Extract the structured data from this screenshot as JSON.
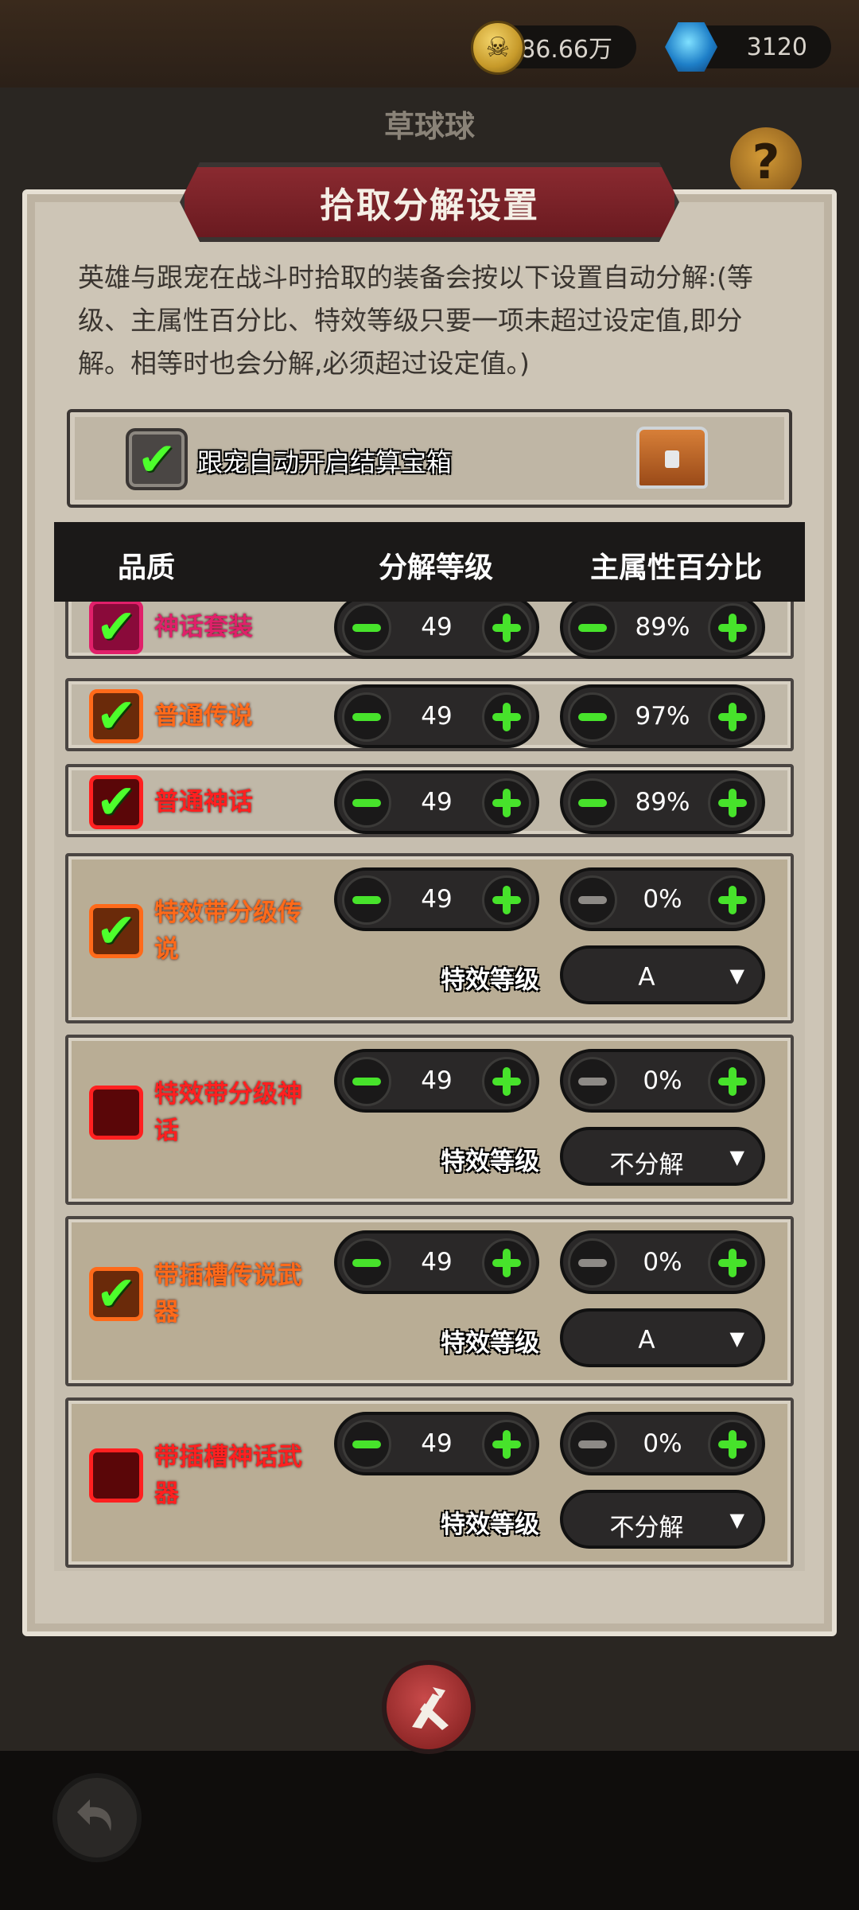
{
  "currency": {
    "gold": "3486.66万",
    "gems": "3120"
  },
  "player_name": "草球球",
  "dialog": {
    "title": "拾取分解设置",
    "description": "英雄与跟宠在战斗时拾取的装备会按以下设置自动分解:(等级、主属性百分比、特效等级只要一项未超过设定值,即分解。相等时也会分解,必须超过设定值。)",
    "pet_auto_open": {
      "label": "跟宠自动开启结算宝箱",
      "checked": true
    }
  },
  "table": {
    "headers": {
      "quality": "品质",
      "level": "分解等级",
      "attr": "主属性百分比"
    },
    "fx_label": "特效等级",
    "rows": [
      {
        "quality": "神话套装",
        "color": "#e0206a",
        "checked": true,
        "level": "49",
        "attr": "89%"
      },
      {
        "quality": "普通传说",
        "color": "#ff6a1a",
        "checked": true,
        "level": "49",
        "attr": "97%"
      },
      {
        "quality": "普通神话",
        "color": "#ff2020",
        "checked": true,
        "level": "49",
        "attr": "89%"
      },
      {
        "quality": "特效带分级传说",
        "color": "#ff6a1a",
        "checked": true,
        "level": "49",
        "attr": "0%",
        "fx": "A"
      },
      {
        "quality": "特效带分级神话",
        "color": "#ff2020",
        "checked": false,
        "level": "49",
        "attr": "0%",
        "fx": "不分解"
      },
      {
        "quality": "带插槽传说武器",
        "color": "#ff6a1a",
        "checked": true,
        "level": "49",
        "attr": "0%",
        "fx": "A"
      },
      {
        "quality": "带插槽神话武器",
        "color": "#ff2020",
        "checked": false,
        "level": "49",
        "attr": "0%",
        "fx": "不分解"
      }
    ]
  },
  "icons": {
    "coin": "skull-coin-icon",
    "gem": "gem-icon",
    "help": "question-icon",
    "close": "close-icon",
    "back": "back-arrow-icon",
    "chest": "chest-icon"
  },
  "glyphs": {
    "help": "?",
    "check": "✔",
    "dropdown": "▼"
  }
}
